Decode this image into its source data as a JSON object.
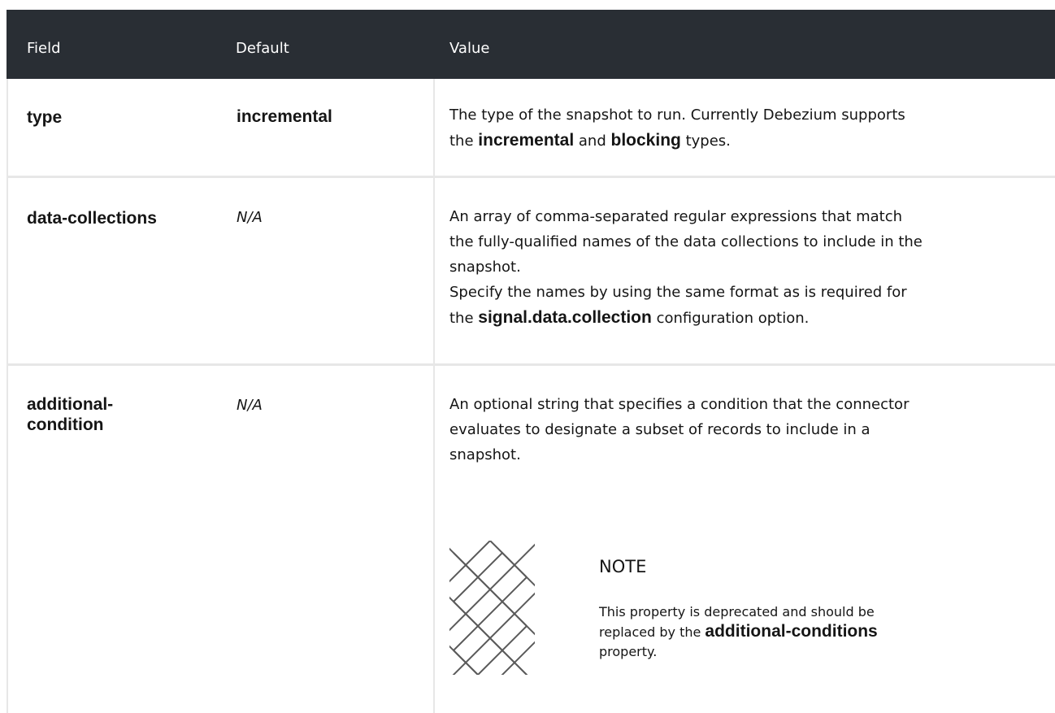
{
  "headers": {
    "field": "Field",
    "default": "Default",
    "value": "Value"
  },
  "rows": [
    {
      "field": "type",
      "default": "incremental",
      "value_parts": {
        "a": "The type of the snapshot to run. Currently Debezium supports",
        "b": "the",
        "c": "incremental",
        "d": "and",
        "e": "blocking",
        "f": "types."
      }
    },
    {
      "field": "data-collections",
      "default": "N/A",
      "value_parts": {
        "l1": "An array of comma-separated regular expressions that match",
        "l2": "the fully-qualified names of the data collections to include in the",
        "l3": "snapshot.",
        "l4": "Specify the names by using the same format as is required for",
        "l5a": "the",
        "l5b": "signal.data.collection",
        "l5c": "configuration option."
      }
    },
    {
      "field_line1": "additional-",
      "field_line2": "condition",
      "default": "N/A",
      "value_parts": {
        "l1": "An optional string that specifies a condition that the connector",
        "l2": "evaluates to designate a subset of records to include in a",
        "l3": "snapshot."
      },
      "note": {
        "icon": "note-pattern-icon",
        "title": "NOTE",
        "l1": "This property is deprecated and should be",
        "l2a": "replaced by the",
        "l2b": "additional-conditions",
        "l3": "property."
      }
    }
  ],
  "colors": {
    "header_bg": "#292e34",
    "header_text": "#ffffff",
    "border": "#e7e7e7",
    "text": "#151515"
  }
}
